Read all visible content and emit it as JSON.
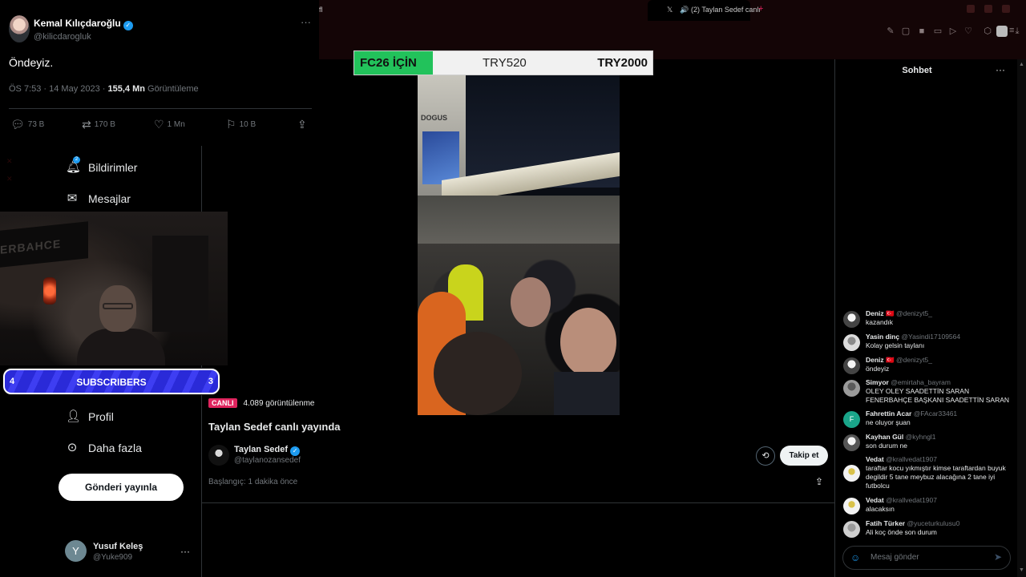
{
  "browser": {
    "partial_tab": "fl",
    "active_tab": "(2) Taylan Sedef canlı",
    "new_tab": "+"
  },
  "tweet": {
    "name": "Kemal Kılıçdaroğlu",
    "handle": "@kilicdarogluk",
    "text": "Öndeyiz.",
    "time": "ÖS 7:53 · 14 May 2023 · ",
    "views_count": "155,4 Mn",
    "views_label": " Görüntüleme",
    "replies": "73 B",
    "retweets": "170 B",
    "likes": "1 Mn",
    "bookmarks": "10 B",
    "more": "···"
  },
  "nav": {
    "notifications": "Bildirimler",
    "notifications_badge": "2",
    "messages": "Mesajlar",
    "profile": "Profil",
    "more": "Daha fazla",
    "post_button": "Gönderi yayınla",
    "user_initial": "Y",
    "user_name": "Yusuf Keleş",
    "user_handle": "@Yuke909",
    "user_more": "···"
  },
  "subscribers": {
    "left": "4",
    "label": "SUBSCRIBERS",
    "right": "3"
  },
  "webcam": {
    "banner_text": "ERBAHCE"
  },
  "promo": {
    "label": "FC26 İÇİN",
    "price_old": "TRY520",
    "price_new": "TRY2000",
    "color": "#22c25b"
  },
  "video_overlay": {
    "sign": "DOGUS"
  },
  "stream": {
    "live_badge": "CANLI",
    "views": "4.089 görüntülenme",
    "title": "Taylan Sedef canlı yayında",
    "host_name": "Taylan Sedef",
    "host_handle": "@taylanozansedef",
    "started": "Başlangıç: 1 dakika önce",
    "follow_button": "Takip et"
  },
  "chat": {
    "title": "Sohbet",
    "more": "···",
    "input_placeholder": "Mesaj gönder",
    "messages": [
      {
        "name": "Deniz 🇹🇷",
        "handle": "@denizyt5_",
        "text": "kazandık",
        "avatar": ""
      },
      {
        "name": "Yasin dinç",
        "handle": "@Yasindi17109564",
        "text": "Kolay gelsin taylanı",
        "avatar": ""
      },
      {
        "name": "Deniz 🇹🇷",
        "handle": "@denizyt5_",
        "text": "öndeyiz",
        "avatar": ""
      },
      {
        "name": "Simyor",
        "handle": "@emirtaha_bayram",
        "text": "OLEY OLEY SAADETTİN SARAN FENERBAHÇE BAŞKANI SAADETTİN SARAN",
        "avatar": ""
      },
      {
        "name": "Fahrettin Acar",
        "handle": "@FAcar33461",
        "text": "ne oluyor şuan",
        "avatar": "F"
      },
      {
        "name": "Kayhan Gül",
        "handle": "@kyhngl1",
        "text": "son durum ne",
        "avatar": ""
      },
      {
        "name": "Vedat",
        "handle": "@krallvedat1907",
        "text": "taraftar kocu yıkmıştır kimse taraftardan buyuk degildir 5 tane meybuz alacağına 2 tane iyi futbolcu",
        "avatar": ""
      },
      {
        "name": "Vedat",
        "handle": "@krallvedat1907",
        "text": "alacaksın",
        "avatar": ""
      },
      {
        "name": "Fatih Türker",
        "handle": "@yuceturkulusu0",
        "text": "Ali koç önde son durum",
        "avatar": ""
      }
    ]
  },
  "colors": {
    "accent": "#1d9bf0",
    "live": "#e0245e",
    "subs_bar": "#2a2ad8",
    "fahrettin_avatar": "#1aa58a"
  }
}
